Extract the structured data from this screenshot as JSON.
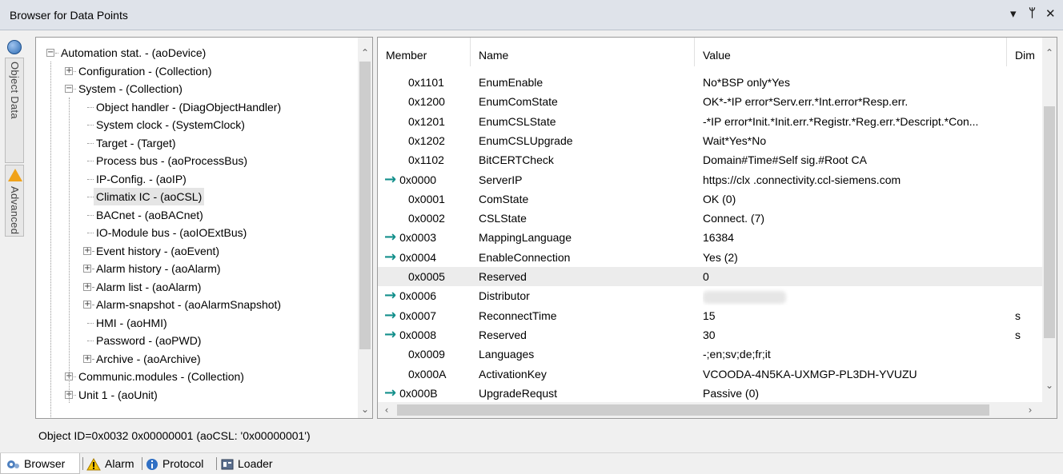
{
  "window": {
    "title": "Browser for Data Points",
    "controls": [
      "▾",
      "ᛘ",
      "✕"
    ]
  },
  "side_tabs": [
    "Object Data",
    "Advanced"
  ],
  "tree": {
    "items": [
      {
        "label": "Automation stat. - (aoDevice)",
        "level": 0,
        "expander": "−"
      },
      {
        "label": "Configuration - (Collection)",
        "level": 1,
        "expander": "+"
      },
      {
        "label": "System - (Collection)",
        "level": 1,
        "expander": "−"
      },
      {
        "label": "Object handler - (DiagObjectHandler)",
        "level": 2,
        "expander": ""
      },
      {
        "label": "System clock - (SystemClock)",
        "level": 2,
        "expander": ""
      },
      {
        "label": "Target - (Target)",
        "level": 2,
        "expander": ""
      },
      {
        "label": "Process bus - (aoProcessBus)",
        "level": 2,
        "expander": ""
      },
      {
        "label": "IP-Config. - (aoIP)",
        "level": 2,
        "expander": ""
      },
      {
        "label": "Climatix IC - (aoCSL)",
        "level": 2,
        "expander": "",
        "selected": true
      },
      {
        "label": "BACnet - (aoBACnet)",
        "level": 2,
        "expander": ""
      },
      {
        "label": "IO-Module bus - (aoIOExtBus)",
        "level": 2,
        "expander": ""
      },
      {
        "label": "Event history - (aoEvent)",
        "level": 2,
        "expander": "+"
      },
      {
        "label": "Alarm history - (aoAlarm)",
        "level": 2,
        "expander": "+"
      },
      {
        "label": "Alarm list - (aoAlarm)",
        "level": 2,
        "expander": "+"
      },
      {
        "label": "Alarm-snapshot - (aoAlarmSnapshot)",
        "level": 2,
        "expander": "+"
      },
      {
        "label": "HMI - (aoHMI)",
        "level": 2,
        "expander": ""
      },
      {
        "label": "Password - (aoPWD)",
        "level": 2,
        "expander": ""
      },
      {
        "label": "Archive - (aoArchive)",
        "level": 2,
        "expander": "+"
      },
      {
        "label": "Communic.modules - (Collection)",
        "level": 1,
        "expander": "+"
      },
      {
        "label": "Unit 1 - (aoUnit)",
        "level": 1,
        "expander": "+"
      }
    ]
  },
  "grid": {
    "columns": [
      "Member",
      "Name",
      "Value",
      "Dim"
    ],
    "rows": [
      {
        "member": "0x1101",
        "name": "EnumEnable",
        "value": "No*BSP only*Yes",
        "dim": "",
        "arrow": false
      },
      {
        "member": "0x1200",
        "name": "EnumComState",
        "value": "OK*-*IP error*Serv.err.*Int.error*Resp.err.",
        "dim": "",
        "arrow": false
      },
      {
        "member": "0x1201",
        "name": "EnumCSLState",
        "value": "-*IP error*Init.*Init.err.*Registr.*Reg.err.*Descript.*Con...",
        "dim": "",
        "arrow": false
      },
      {
        "member": "0x1202",
        "name": "EnumCSLUpgrade",
        "value": "Wait*Yes*No",
        "dim": "",
        "arrow": false
      },
      {
        "member": "0x1102",
        "name": "BitCERTCheck",
        "value": "Domain#Time#Self sig.#Root CA",
        "dim": "",
        "arrow": false
      },
      {
        "member": "0x0000",
        "name": "ServerIP",
        "value": " https://clx .connectivity.ccl-siemens.com",
        "dim": "",
        "arrow": true
      },
      {
        "member": "0x0001",
        "name": "ComState",
        "value": "OK (0)",
        "dim": "",
        "arrow": false
      },
      {
        "member": "0x0002",
        "name": "CSLState",
        "value": "Connect. (7)",
        "dim": "",
        "arrow": false
      },
      {
        "member": "0x0003",
        "name": "MappingLanguage",
        "value": "16384",
        "dim": "",
        "arrow": true
      },
      {
        "member": "0x0004",
        "name": "EnableConnection",
        "value": "Yes (2)",
        "dim": "",
        "arrow": true
      },
      {
        "member": "0x0005",
        "name": "Reserved",
        "value": "0",
        "dim": "",
        "arrow": false,
        "highlight": true
      },
      {
        "member": "0x0006",
        "name": "Distributor",
        "value": "",
        "dim": "",
        "arrow": true,
        "blurred": true
      },
      {
        "member": "0x0007",
        "name": "ReconnectTime",
        "value": "15",
        "dim": "s",
        "arrow": true
      },
      {
        "member": "0x0008",
        "name": "Reserved",
        "value": "30",
        "dim": "s",
        "arrow": true
      },
      {
        "member": "0x0009",
        "name": "Languages",
        "value": "-;en;sv;de;fr;it",
        "dim": "",
        "arrow": false
      },
      {
        "member": "0x000A",
        "name": "ActivationKey",
        "value": "VCOODA-4N5KA-UXMGP-PL3DH-YVUZU",
        "dim": "",
        "arrow": false
      },
      {
        "member": "0x000B",
        "name": "UpgradeRequst",
        "value": "Passive (0)",
        "dim": "",
        "arrow": true
      }
    ]
  },
  "status_text": "Object ID=0x0032 0x00000001 (aoCSL: '0x00000001')",
  "bottom_tabs": [
    "Browser",
    "Alarm",
    "Protocol",
    "Loader"
  ],
  "colors": {
    "arrow": "#138f8b",
    "titlebar": "#dfe3ea",
    "selected": "#e5e5e5"
  }
}
